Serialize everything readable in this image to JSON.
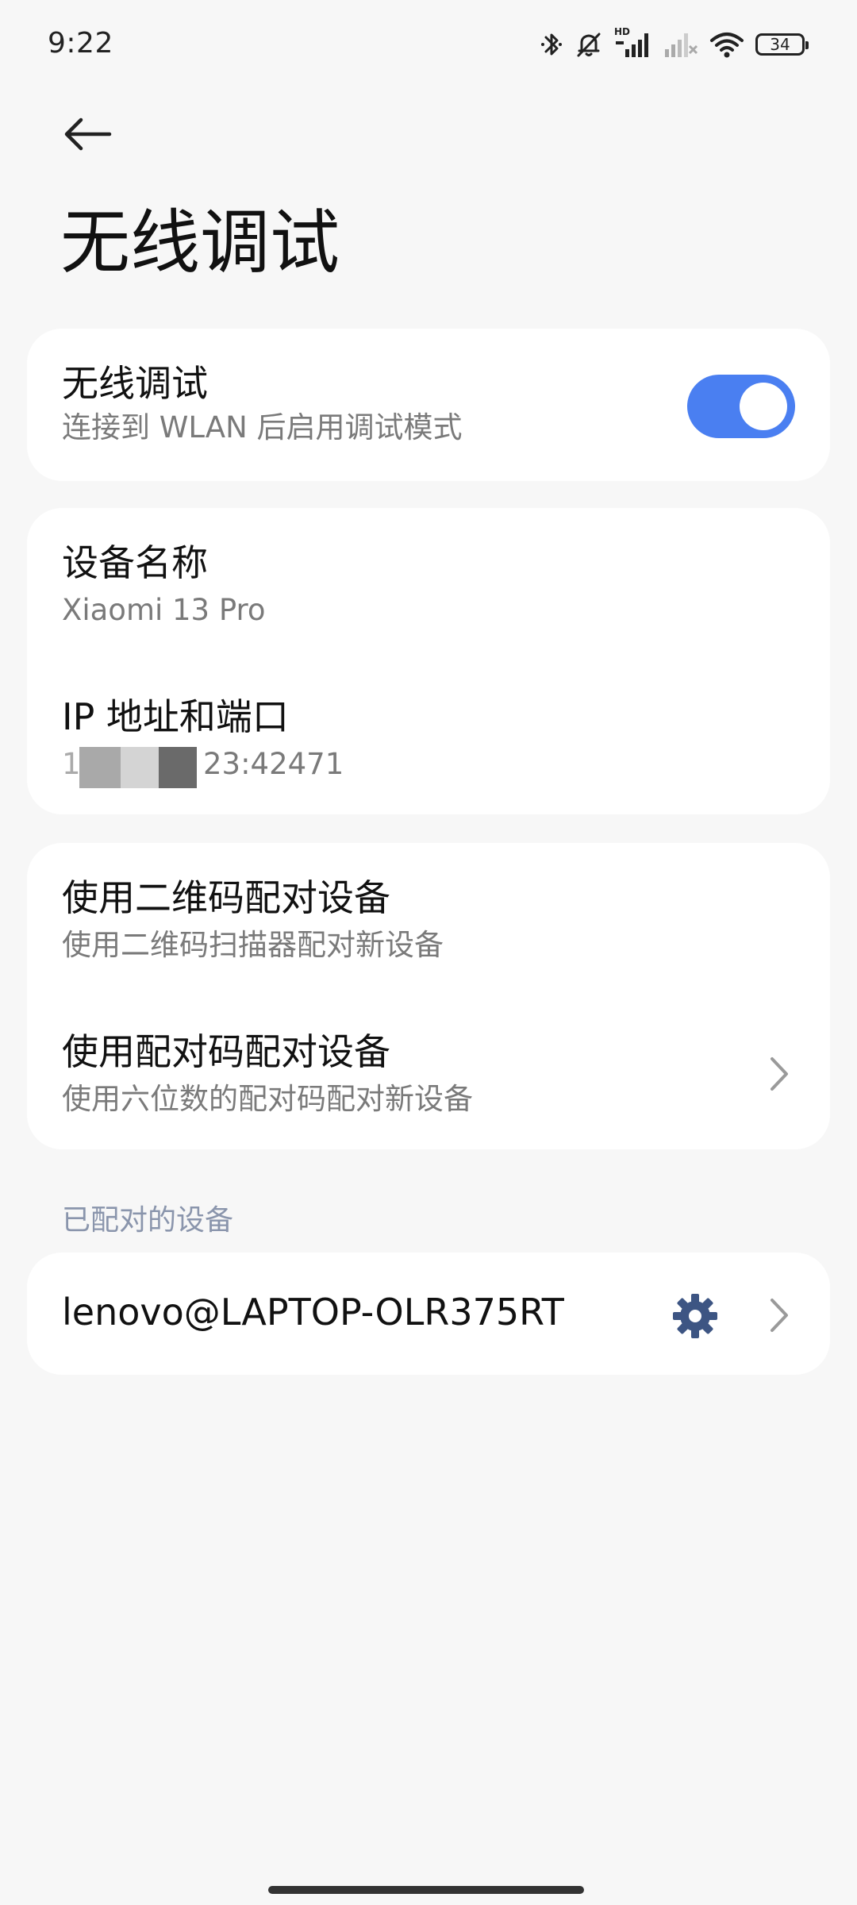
{
  "status_bar": {
    "time": "9:22",
    "battery": "34",
    "network_badge": "HD",
    "icons": [
      "bluetooth-icon",
      "silent-bell-icon",
      "signal-icon",
      "signal-weak-icon",
      "wifi-icon",
      "battery-icon"
    ]
  },
  "header": {
    "back_icon": "back-arrow-icon",
    "title": "无线调试"
  },
  "wireless_card": {
    "title": "无线调试",
    "subtitle": "连接到 WLAN 后启用调试模式",
    "toggle_on": true,
    "accent_color": "#4a7ff1"
  },
  "device_card": {
    "name_label": "设备名称",
    "name_value": "Xiaomi 13 Pro",
    "ip_label": "IP 地址和端口",
    "ip_prefix": "1",
    "ip_suffix": "23:42471"
  },
  "pairing_card": {
    "qr_title": "使用二维码配对设备",
    "qr_subtitle": "使用二维码扫描器配对新设备",
    "code_title": "使用配对码配对设备",
    "code_subtitle": "使用六位数的配对码配对新设备"
  },
  "paired_section": {
    "label": "已配对的设备",
    "devices": [
      {
        "name": "lenovo@LAPTOP-OLR375RT",
        "settings_icon": "gear-icon",
        "chevron_icon": "chevron-right-icon"
      }
    ]
  }
}
